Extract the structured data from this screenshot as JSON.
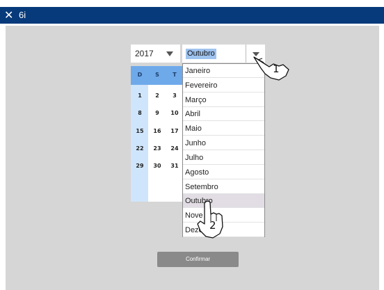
{
  "window": {
    "title": "6i"
  },
  "year_select": {
    "value": "2017"
  },
  "month_select": {
    "value": "Outubro",
    "options": [
      "Janeiro",
      "Fevereiro",
      "Março",
      "Abril",
      "Maio",
      "Junho",
      "Julho",
      "Agosto",
      "Setembro",
      "Outubro",
      "Nove",
      "Deze"
    ],
    "hovered": "Outubro"
  },
  "calendar": {
    "headers": [
      "D",
      "S",
      "T"
    ],
    "rows": [
      [
        "1",
        "2",
        "3"
      ],
      [
        "8",
        "9",
        "10"
      ],
      [
        "15",
        "16",
        "17"
      ],
      [
        "22",
        "23",
        "24"
      ],
      [
        "29",
        "30",
        "31"
      ]
    ]
  },
  "confirm_button": {
    "label": "Confirmar"
  },
  "annotations": {
    "step1": "1",
    "step2": "2"
  },
  "colors": {
    "titlebar": "#063a7a",
    "background": "#d6d6d6",
    "calendar_header": "#6ea9ea",
    "calendar_daycol": "#cfe5fb",
    "selection": "#9fc3ef",
    "hover": "#e2dde4",
    "button": "#8a8a8a"
  }
}
